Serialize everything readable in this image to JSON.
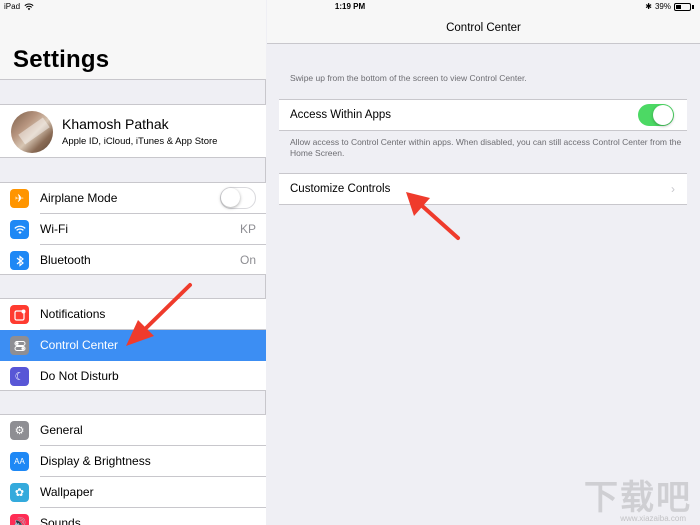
{
  "status": {
    "device": "iPad",
    "time": "1:19 PM",
    "battery_text": "39%",
    "battery_level": 0.39
  },
  "sidebar": {
    "title": "Settings",
    "profile": {
      "name": "Khamosh Pathak",
      "subtitle": "Apple ID, iCloud, iTunes & App Store"
    },
    "group1": [
      {
        "label": "Airplane Mode",
        "icon": "airplane-icon",
        "color": "#ff9500",
        "value": "",
        "toggle": "off"
      },
      {
        "label": "Wi-Fi",
        "icon": "wifi-icon",
        "color": "#1e88f5",
        "value": "KP"
      },
      {
        "label": "Bluetooth",
        "icon": "bluetooth-icon",
        "color": "#1e88f5",
        "value": "On"
      }
    ],
    "group2": [
      {
        "label": "Notifications",
        "icon": "notifications-icon",
        "color": "#ff3b30"
      },
      {
        "label": "Control Center",
        "icon": "control-center-icon",
        "color": "#8e8e93",
        "selected": true
      },
      {
        "label": "Do Not Disturb",
        "icon": "moon-icon",
        "color": "#5856d6"
      }
    ],
    "group3": [
      {
        "label": "General",
        "icon": "gear-icon",
        "color": "#8e8e93"
      },
      {
        "label": "Display & Brightness",
        "icon": "display-icon",
        "color": "#1e88f5"
      },
      {
        "label": "Wallpaper",
        "icon": "wallpaper-icon",
        "color": "#34aadc"
      },
      {
        "label": "Sounds",
        "icon": "sounds-icon",
        "color": "#ff2d55"
      }
    ]
  },
  "detail": {
    "title": "Control Center",
    "intro_note": "Swipe up from the bottom of the screen to view Control Center.",
    "access_label": "Access Within Apps",
    "access_toggle": "on",
    "access_note": "Allow access to Control Center within apps. When disabled, you can still access Control Center from the Home Screen.",
    "customize_label": "Customize Controls"
  },
  "colors": {
    "accent": "#3c8ef3",
    "toggle_on": "#4cd964",
    "annotation_arrow": "#ef3b2c"
  },
  "watermark": {
    "text": "下载吧",
    "sub": "www.xiazaiba.com"
  }
}
